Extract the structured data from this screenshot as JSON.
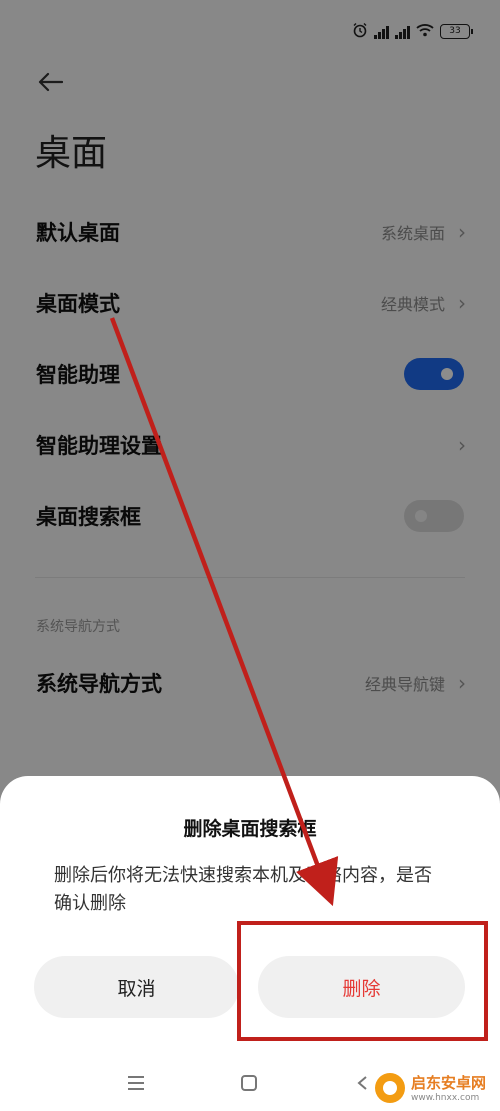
{
  "status_bar": {
    "battery": "33"
  },
  "page": {
    "title": "桌面"
  },
  "settings": [
    {
      "label": "默认桌面",
      "value": "系统桌面"
    },
    {
      "label": "桌面模式",
      "value": "经典模式"
    },
    {
      "label": "智能助理",
      "toggle": "on"
    },
    {
      "label": "智能助理设置"
    },
    {
      "label": "桌面搜索框",
      "toggle": "off"
    }
  ],
  "nav_section": {
    "header": "系统导航方式",
    "label": "系统导航方式",
    "value": "经典导航键"
  },
  "dialog": {
    "title": "删除桌面搜索框",
    "message": "删除后你将无法快速搜索本机及网络内容，是否确认删除",
    "cancel": "取消",
    "confirm": "删除"
  },
  "watermark": {
    "name": "启东安卓网",
    "url": "www.hnxx.com"
  },
  "colors": {
    "accent": "#1f6bf0",
    "danger": "#e53935",
    "annotation": "#c0201b"
  },
  "icons": [
    "back-arrow-icon",
    "chevron-right-icon",
    "alarm-icon",
    "signal-icon",
    "wifi-icon",
    "battery-icon",
    "menu-icon",
    "home-icon",
    "back-icon"
  ]
}
